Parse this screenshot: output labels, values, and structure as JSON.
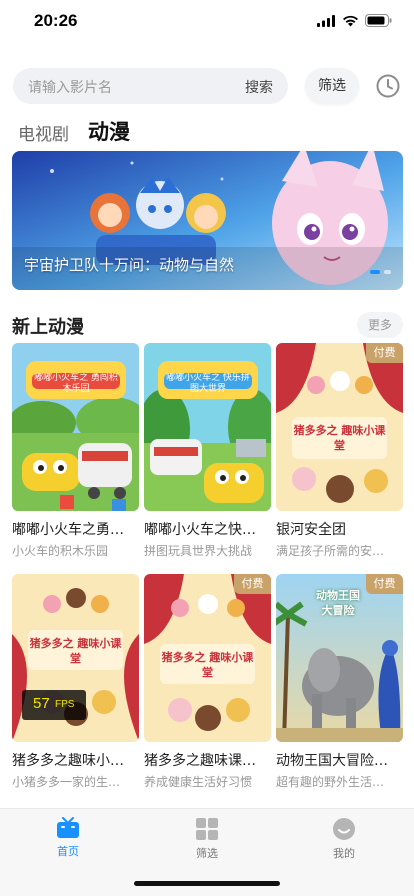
{
  "status_bar": {
    "time": "20:26"
  },
  "search": {
    "placeholder": "请输入影片名",
    "button_label": "搜索"
  },
  "filter_label": "筛选",
  "tabs": [
    {
      "label": "电视剧",
      "active": false
    },
    {
      "label": "动漫",
      "active": true
    }
  ],
  "banner": {
    "caption": "宇宙护卫队十万问：动物与自然",
    "dot_count": 2,
    "active_dot": 0
  },
  "section": {
    "title": "新上动漫",
    "more_label": "更多"
  },
  "cards": [
    {
      "title": "嘟嘟小火车之勇…",
      "subtitle": "小火车的积木乐园",
      "paid": false,
      "thumb_title": "嘟嘟小火车之 勇闯积木乐园"
    },
    {
      "title": "嘟嘟小火车之快…",
      "subtitle": "拼图玩具世界大挑战",
      "paid": false,
      "thumb_title": "嘟嘟小火车之 快乐拼图大世界"
    },
    {
      "title": "银河安全团",
      "subtitle": "满足孩子所需的安…",
      "paid": true,
      "thumb_title": "猪多多之 趣味小课堂"
    },
    {
      "title": "猪多多之趣味小…",
      "subtitle": "小猪多多一家的生…",
      "paid": false,
      "thumb_title": "猪多多之 趣味小课堂"
    },
    {
      "title": "猪多多之趣味课…",
      "subtitle": "养成健康生活好习惯",
      "paid": true,
      "thumb_title": "猪多多之 趣味小课堂"
    },
    {
      "title": "动物王国大冒险…",
      "subtitle": "超有趣的野外生活…",
      "paid": true,
      "thumb_title": "动物王国 大冒险"
    }
  ],
  "pay_label": "付费",
  "fps": {
    "value": "57",
    "label": "FPS"
  },
  "bottom_nav": [
    {
      "label": "首页",
      "icon": "tv-icon",
      "active": true
    },
    {
      "label": "筛选",
      "icon": "grid-icon",
      "active": false
    },
    {
      "label": "我的",
      "icon": "user-face-icon",
      "active": false
    }
  ],
  "colors": {
    "accent": "#1890ff",
    "pay_badge": "#c9a26a",
    "fps_text": "#f3e300"
  }
}
